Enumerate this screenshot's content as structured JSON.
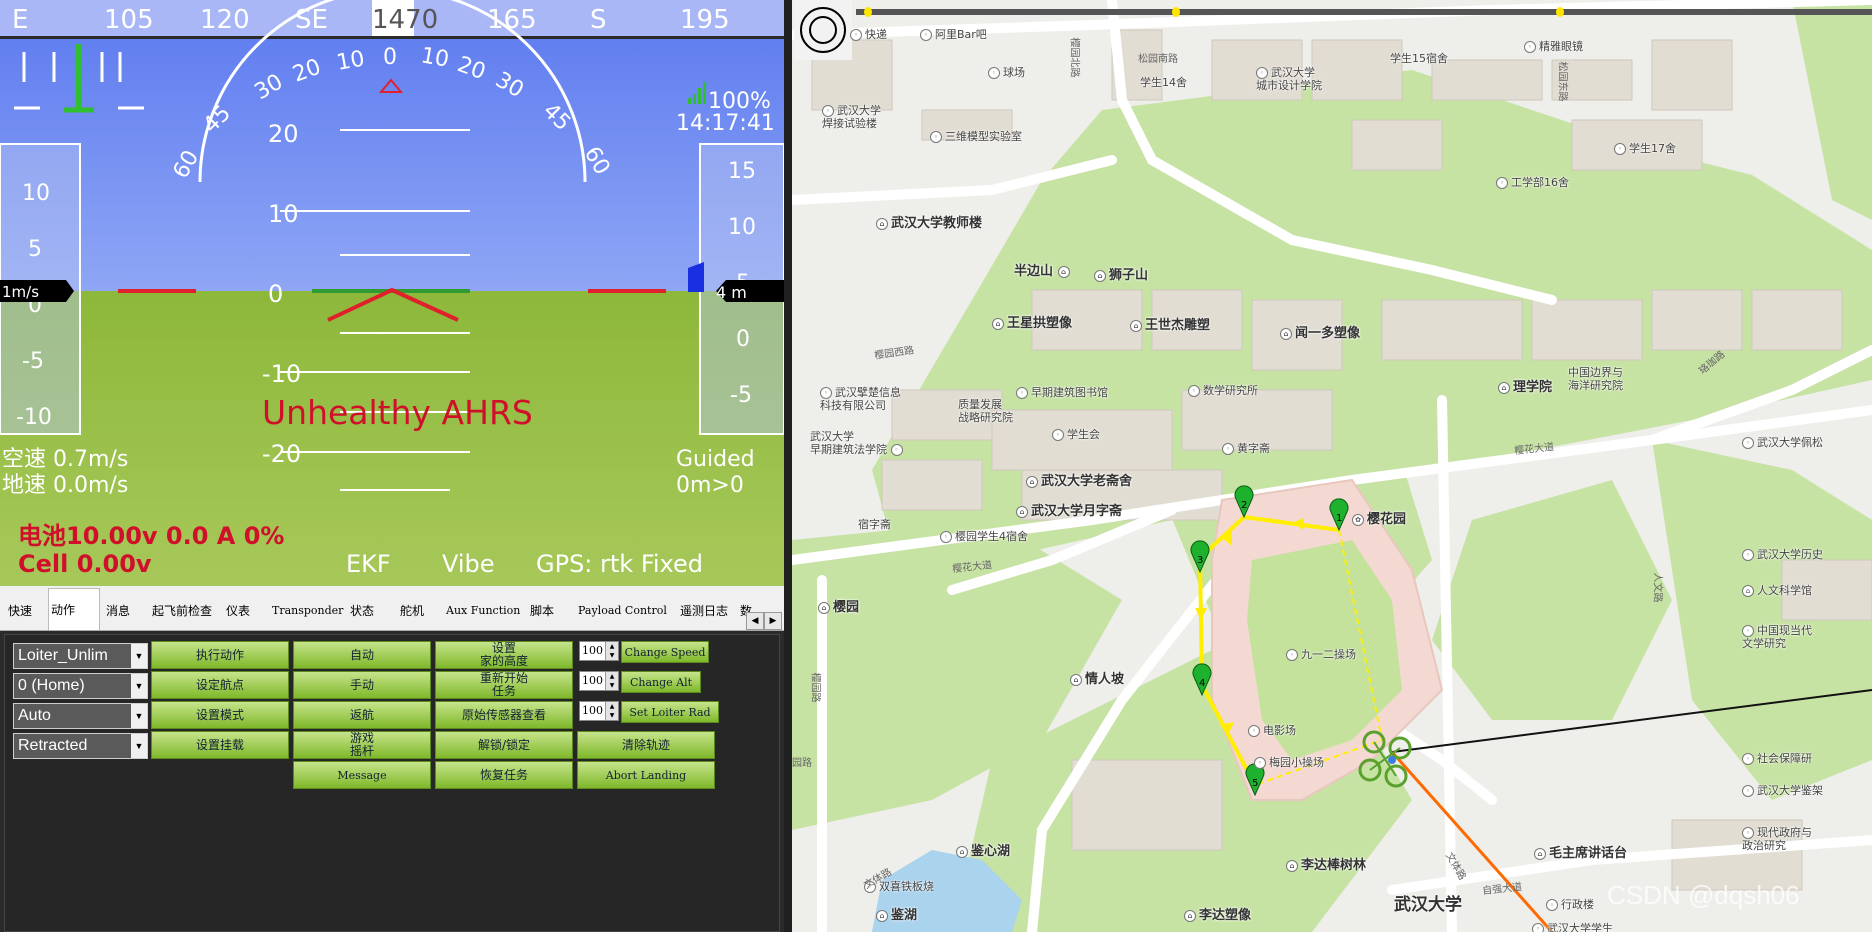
{
  "hud": {
    "heading_labels": [
      "E",
      "105",
      "120",
      "SE",
      "1470",
      "165",
      "S",
      "195"
    ],
    "heading_value": "147",
    "roll_labels": [
      "60",
      "45",
      "30",
      "20",
      "10",
      "0",
      "10",
      "20",
      "30",
      "45",
      "60"
    ],
    "pitch_labels": [
      "20",
      "10",
      "0",
      "-10",
      "-20"
    ],
    "speed_tape": [
      "10",
      "5",
      "0",
      "-5",
      "-10"
    ],
    "speed_value": "1m/s",
    "alt_tape": [
      "15",
      "10",
      "5",
      "0",
      "-5"
    ],
    "alt_value": "4 m",
    "signal_pct": "100%",
    "time": "14:17:41",
    "warning": "Unhealthy AHRS",
    "airspeed": "空速 0.7m/s",
    "groundspeed": "地速 0.0m/s",
    "mode": "Guided",
    "wp_dist": "0m>0",
    "battery": "电池10.00v 0.0 A 0%",
    "cell": "Cell 0.00v",
    "ekf": "EKF",
    "vibe": "Vibe",
    "gps": "GPS: rtk Fixed",
    "colors": {
      "sky": "#6b86f0",
      "ground": "#9cc33a",
      "warning": "#d0102a"
    }
  },
  "tabs": [
    "快速",
    "动作",
    "消息",
    "起飞前检查",
    "仪表",
    "Transponder",
    "状态",
    "舵机",
    "Aux Function",
    "脚本",
    "Payload Control",
    "遥测日志",
    "数"
  ],
  "active_tab": 1,
  "actions": {
    "selects": [
      "Loiter_Unlim",
      "0 (Home)",
      "Auto",
      "Retracted"
    ],
    "col1": [
      "执行动作",
      "设定航点",
      "设置模式",
      "设置挂载"
    ],
    "col2": [
      "自动",
      "手动",
      "返航",
      "游戏\n摇杆",
      "Message"
    ],
    "col3": [
      "设置\n家的高度",
      "重新开始\n任务",
      "原始传感器查看",
      "解锁/锁定",
      "恢复任务"
    ],
    "nums": [
      "100",
      "100",
      "100"
    ],
    "col4": [
      "Change Speed",
      "Change Alt",
      "Set Loiter Rad",
      "清除轨迹",
      "Abort Landing"
    ]
  },
  "map": {
    "timeline_start": "0",
    "labels": {
      "campus": "武汉大学",
      "teachers": "武汉大学教师楼",
      "banbianshan": "半边山",
      "shizishan": "狮子山",
      "wangxing": "王星拱塑像",
      "wangshijie": "王世杰雕塑",
      "wenyiduo": "闻一多塑像",
      "lixue": "理学院",
      "yinghuayuan": "樱花园",
      "laozhaishe": "武汉大学老斋舍",
      "yuezishe": "武汉大学月字斋",
      "qingrenpo": "情人坡",
      "jianxinhu": "鉴心湖",
      "jianhu": "鉴湖",
      "lidazhao": "李达棒树林",
      "mao": "毛主席讲话台",
      "yingyuan": "樱园",
      "jiuyier": "九一二操场",
      "meiyuan": "梅园小操场",
      "dianyingchang": "电影场",
      "zaoqi": "早期建筑图书馆",
      "shuxue": "数学研究所",
      "xueshenghui": "学生会",
      "huangzhai": "黄字斋",
      "ying4": "樱园学生4宿舍",
      "suzi": "宿字斋",
      "chuxin": "武汉擘楚信息\n科技有限公司",
      "zhiliang": "质量发展\n战略研究院",
      "zaoqijz": "武汉大学\n早期建筑法学院",
      "qiuchang": "球场",
      "sanwei": "三维模型实验室",
      "hanjie": "武汉大学\n焊接试验楼",
      "xs14": "学生14舍",
      "chengshi": "武汉大学\n城市设计学院",
      "xs15": "学生15宿舍",
      "jingya": "精雅眼镜",
      "xs17": "学生17舍",
      "gx16": "工学部16舍",
      "alibar": "阿里Bar吧",
      "kuaidi": "快递",
      "bianjie": "中国边界与\n海洋研究院",
      "peisong": "武汉大学佩松",
      "lishi": "武汉大学历史",
      "renwen": "人文科学馆",
      "zhongguo": "中国现当代\n文学研究",
      "shehui": "社会保障研",
      "yingjia": "武汉大学鉴架",
      "xiandai": "现代政府与\n政治研究",
      "xingzheng": "行政楼",
      "xuesheng": "武汉大学学生",
      "shuangxi": "双喜铁板烧",
      "lidazx": "李达塑像"
    },
    "roads": {
      "songyuan": "松园南路",
      "yingyuanbei": "樱园北路",
      "yingyuanxi": "樱园西路",
      "yinghua1": "樱花大道",
      "yinghua2": "樱花大道",
      "wentilu": "文体路",
      "wentilu2": "文体路",
      "ziqiang": "自强大道",
      "renwen": "人文路",
      "songyuandong": "松园东路",
      "yingyuanl": "樱园路",
      "luojia": "珞珈路",
      "yuanlu": "园路"
    },
    "waypoints": [
      "1",
      "2",
      "3",
      "4",
      "5"
    ],
    "watermark": "CSDN @dqsh06",
    "colors": {
      "route": "#ffee00",
      "home_line": "#ff6a00",
      "track": "#ff8a00",
      "vehicle": "#5aa02c"
    }
  }
}
